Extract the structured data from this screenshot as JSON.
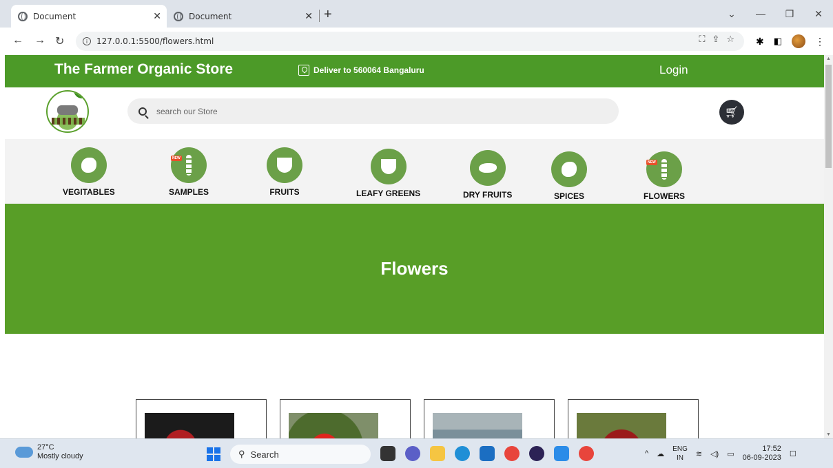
{
  "browser": {
    "tabs": [
      {
        "title": "Document",
        "active": true
      },
      {
        "title": "Document",
        "active": false
      }
    ],
    "url": "127.0.0.1:5500/flowers.html"
  },
  "site": {
    "brand": "The Farmer Organic Store",
    "deliver": "Deliver to 560064 Bangaluru",
    "login": "Login",
    "search_placeholder": "search our Store"
  },
  "categories": [
    {
      "label": "VEGITABLES",
      "icon": "vegetables-icon",
      "new": false
    },
    {
      "label": "SAMPLES",
      "icon": "wheat-icon",
      "new": true
    },
    {
      "label": "FRUITS",
      "icon": "fruit-basket-icon",
      "new": false
    },
    {
      "label": "LEAFY GREENS",
      "icon": "leafy-greens-icon",
      "new": false
    },
    {
      "label": "DRY FRUITS",
      "icon": "dry-fruits-icon",
      "new": false
    },
    {
      "label": "SPICES",
      "icon": "ginger-icon",
      "new": false
    },
    {
      "label": "FLOWERS",
      "icon": "wheat-icon",
      "new": true
    }
  ],
  "new_badge": "NEW",
  "hero": {
    "title": "Flowers"
  },
  "colors": {
    "brand_green": "#4c9a28",
    "hero_green": "#589e27",
    "category_green": "#6ba048"
  },
  "taskbar": {
    "weather_temp": "27°C",
    "weather_desc": "Mostly cloudy",
    "search": "Search",
    "lang_top": "ENG",
    "lang_bottom": "IN",
    "time": "17:52",
    "date": "06-09-2023"
  }
}
